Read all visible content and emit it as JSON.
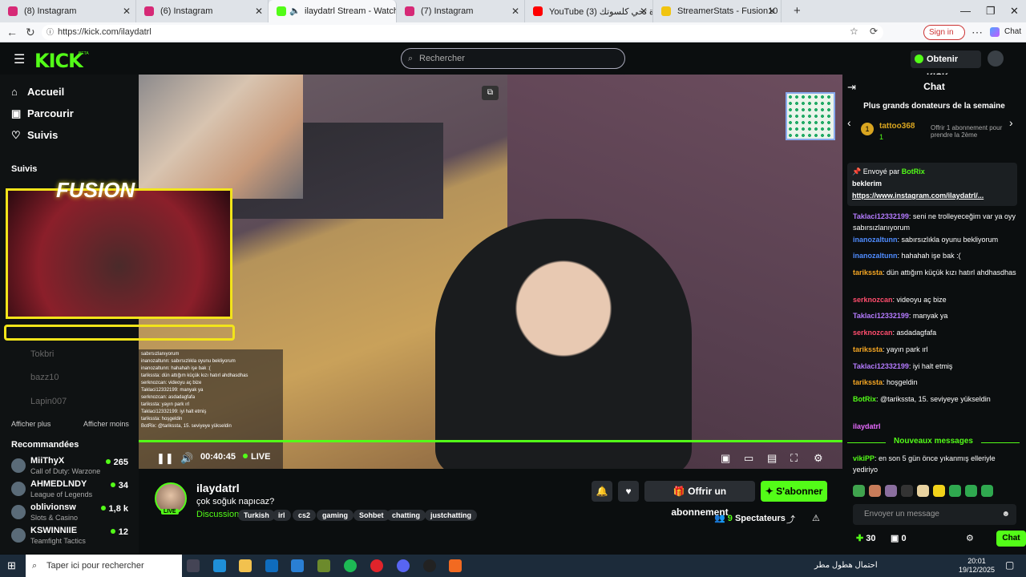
{
  "browser": {
    "tabs": [
      {
        "label": "(8) Instagram",
        "color": "#d62976"
      },
      {
        "label": "(6) Instagram",
        "color": "#d62976"
      },
      {
        "label": "ilaydatrl Stream - Watch Live o",
        "color": "#53fc18"
      },
      {
        "label": "(7) Instagram",
        "color": "#d62976"
      },
      {
        "label": "YouTube (3) يا سمرة تحي كلسوتك",
        "color": "#ff0000"
      },
      {
        "label": "StreamerStats - Fusion10 Stream",
        "color": "#f1c40f"
      }
    ],
    "url": "https://kick.com/ilaydatrl",
    "signin": "Sign in",
    "chat_label": "Chat"
  },
  "header": {
    "logo": "KICK",
    "beta": "BETA",
    "search_placeholder": "Rechercher",
    "kicks_button": "Obtenir KICKs"
  },
  "sidebar": {
    "nav": [
      {
        "label": "Accueil",
        "icon": "home-icon"
      },
      {
        "label": "Parcourir",
        "icon": "browse-icon"
      },
      {
        "label": "Suivis",
        "icon": "heart-icon"
      }
    ],
    "following_title": "Suivis",
    "offline": [
      "Tokbri",
      "bazz10",
      "Lapin007"
    ],
    "show_more": "Afficher plus",
    "show_less": "Afficher moins",
    "recommended_title": "Recommandées",
    "recommended": [
      {
        "name": "MiiThyX",
        "game": "Call of Duty: Warzone",
        "viewers": "265"
      },
      {
        "name": "AHMEDLNDY",
        "game": "League of Legends",
        "viewers": "34"
      },
      {
        "name": "oblivionsw",
        "game": "Slots & Casino",
        "viewers": "1,8 k"
      },
      {
        "name": "KSWINNIIE",
        "game": "Teamfight Tactics",
        "viewers": "12"
      }
    ]
  },
  "player": {
    "overlay_title": "FUSION",
    "time": "00:40:45",
    "live": "LIVE",
    "overlay_chat": [
      "sabırsızlanıyorum",
      "inanozaltunn: sabırsızlıkla oyunu bekliyorum",
      "inanozaltunn: hahahah işe bak :(",
      "tarikssta: dün attığım küçük kızı hatırl ahdhasdhas",
      "serknozcan: videoyu aç bize",
      "Taklaci12332199: manyak ya",
      "serknozcan: asdadagfafa",
      "tarikssta: yayın park ırl",
      "Taklaci12332199: iyi halt etmiş",
      "tarikssta: hoşgeldin",
      "BotRix: @tarikssta, 15. seviyeye yükseldin"
    ]
  },
  "stream": {
    "streamer": "ilaydatrl",
    "live_badge": "LIVE",
    "title": "çok soğuk napıcaz?",
    "category": "Discussion",
    "tags": [
      "Turkish",
      "irl",
      "cs2",
      "gaming",
      "Sohbet",
      "chatting",
      "justchatting"
    ],
    "gift_button": "Offrir un abonnement",
    "subscribe_button": "S'abonner",
    "viewers_count": "9",
    "viewers_label": "Spectateurs"
  },
  "chat": {
    "title": "Chat",
    "donors_title": "Plus grands donateurs de la semaine",
    "top_donor": "tattoo368",
    "top_donor_count": "1",
    "donor_offer": "Offrir 1 abonnement pour prendre la 2ème",
    "pinned_sent_by": "Envoyé par",
    "pinned_user": "BotRix",
    "pinned_text": "beklerim",
    "pinned_link": "https://www.instagram.com/ilaydatrl/...",
    "messages": [
      {
        "user": "Taklaci12332199",
        "color": "#b57bff",
        "text": "seni ne trolleyeceğim var ya oyy sabırsızlanıyorum"
      },
      {
        "user": "inanozaltunn",
        "color": "#4f8cff",
        "text": "sabırsızlıkla oyunu bekliyorum"
      },
      {
        "user": "inanozaltunn",
        "color": "#4f8cff",
        "text": "hahahah işe bak :("
      },
      {
        "user": "tarikssta",
        "color": "#f5a623",
        "text": "dün attığım küçük kızı hatırl ahdhasdhas"
      },
      {
        "user": "serknozcan",
        "color": "#ff4d6d",
        "text": "videoyu aç bize"
      },
      {
        "user": "Taklaci12332199",
        "color": "#b57bff",
        "text": "manyak ya"
      },
      {
        "user": "serknozcan",
        "color": "#ff4d6d",
        "text": "asdadagfafa"
      },
      {
        "user": "tarikssta",
        "color": "#f5a623",
        "text": "yayın park ırl"
      },
      {
        "user": "Taklaci12332199",
        "color": "#b57bff",
        "text": "iyi halt etmiş"
      },
      {
        "user": "tarikssta",
        "color": "#f5a623",
        "text": "hoşgeldin"
      },
      {
        "user": "BotRix",
        "color": "#53fc18",
        "text": "@tarikssta, 15. seviyeye yükseldin"
      },
      {
        "user": "ilaydatrl",
        "color": "#e86bff",
        "text": ""
      }
    ],
    "new_messages": "Nouveaux messages",
    "latest": {
      "user": "vikiPP",
      "color": "#53fc18",
      "text": "en son 5 gün önce yıkanmış elleriyle yediriyo"
    },
    "input_placeholder": "Envoyer un message",
    "points": "30",
    "gifts": "0",
    "send_button": "Chat"
  },
  "taskbar": {
    "search": "Taper ici pour rechercher",
    "weather": "احتمال هطول مطر",
    "time": "20:01",
    "date": "19/12/2025"
  },
  "colors": {
    "accent": "#53fc18",
    "overlay_yellow": "#f2e41a"
  }
}
